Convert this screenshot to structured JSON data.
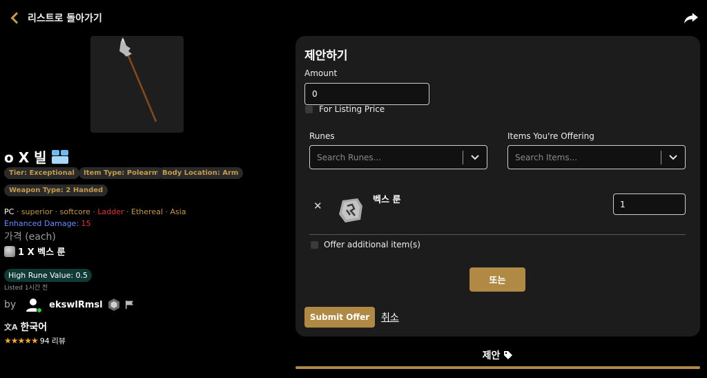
{
  "header": {
    "back_label": "리스트로 돌아가기"
  },
  "item": {
    "title": "o X 빌",
    "tags": [
      "Tier: Exceptional",
      "Item Type: Polearm",
      "Body Location: Arm",
      "Weapon Type: 2 Handed"
    ],
    "platform": "PC",
    "attrs": {
      "quality": "superior",
      "mode": "softcore",
      "ladder": "Ladder",
      "ethereal": "Ethereal",
      "region": "Asia"
    },
    "enhanced_damage_label": "Enhanced Damage:",
    "enhanced_damage_value": "15",
    "price_label": "가격 (each)",
    "price_value": "1 X 벡스 룬",
    "high_rune_value": "High Rune Value: 0.5",
    "listed": "Listed 1시간 전"
  },
  "seller": {
    "by_label": "by",
    "name": "ekswlRmsl",
    "language": "한국어",
    "stars": "★★★★★",
    "reviews_count": "94",
    "reviews_label": "리뷰"
  },
  "offer": {
    "title": "제안하기",
    "amount_label": "Amount",
    "amount_value": "0",
    "listing_price_label": "For Listing Price",
    "runes_label": "Runes",
    "runes_placeholder": "Search Runes...",
    "items_label": "Items You're Offering",
    "items_placeholder": "Search Items...",
    "rune_name": "벡스 룬",
    "rune_qty": "1",
    "additional_label": "Offer additional item(s)",
    "or_label": "또는",
    "submit_label": "Submit Offer",
    "cancel_label": "취소"
  },
  "offers_section": {
    "heading": "제안"
  },
  "colors": {
    "accent": "#b08a45",
    "panel": "#1c1c1c",
    "ladder": "#e03a3a",
    "enhanced": "#6a8cff",
    "rating": "#f0a83a"
  }
}
